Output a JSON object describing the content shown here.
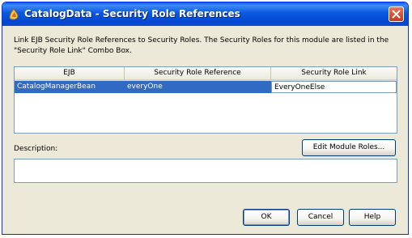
{
  "window": {
    "title": "CatalogData - Security Role References"
  },
  "description": "Link EJB Security Role References to Security Roles. The Security Roles for this module are listed in the \"Security Role Link\" Combo Box.",
  "table": {
    "columns": [
      "EJB",
      "Security Role Reference",
      "Security Role Link"
    ],
    "rows": [
      [
        "CatalogManagerBean",
        "everyOne",
        "EveryOneElse"
      ]
    ]
  },
  "description_field": {
    "label": "Description:",
    "value": ""
  },
  "buttons": {
    "edit_module_roles": "Edit Module Roles...",
    "ok": "OK",
    "cancel": "Cancel",
    "help": "Help"
  }
}
